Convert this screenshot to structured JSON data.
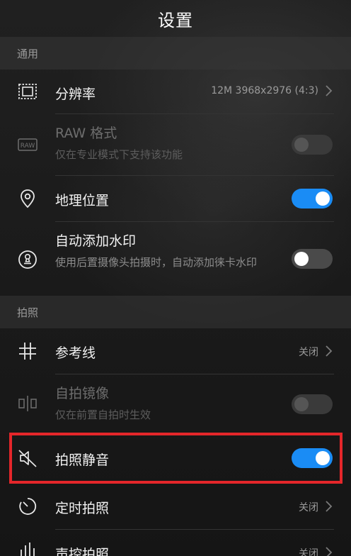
{
  "title": "设置",
  "sections": {
    "general": "通用",
    "photo": "拍照"
  },
  "items": {
    "resolution": {
      "label": "分辨率",
      "value": "12M 3968x2976 (4:3)"
    },
    "raw": {
      "label": "RAW 格式",
      "sub": "仅在专业模式下支持该功能",
      "state": "off",
      "disabled": true
    },
    "location": {
      "label": "地理位置",
      "state": "on"
    },
    "watermark": {
      "label": "自动添加水印",
      "sub": "使用后置摄像头拍摄时，自动添加徕卡水印",
      "state": "off"
    },
    "gridlines": {
      "label": "参考线",
      "value": "关闭"
    },
    "mirror": {
      "label": "自拍镜像",
      "sub": "仅在前置自拍时生效",
      "state": "off",
      "disabled": true
    },
    "mute": {
      "label": "拍照静音",
      "state": "on"
    },
    "timer": {
      "label": "定时拍照",
      "value": "关闭"
    },
    "voice": {
      "label": "声控拍照",
      "value": "关闭"
    }
  },
  "colors": {
    "accent": "#1a8cf5",
    "highlight": "#e4262a",
    "background": "#1b1b1b"
  },
  "icons": [
    "resolution-icon",
    "raw-icon",
    "location-pin-icon",
    "stamp-icon",
    "grid-icon",
    "mirror-icon",
    "mute-icon",
    "timer-icon",
    "voice-control-icon",
    "chevron-right-icon"
  ]
}
